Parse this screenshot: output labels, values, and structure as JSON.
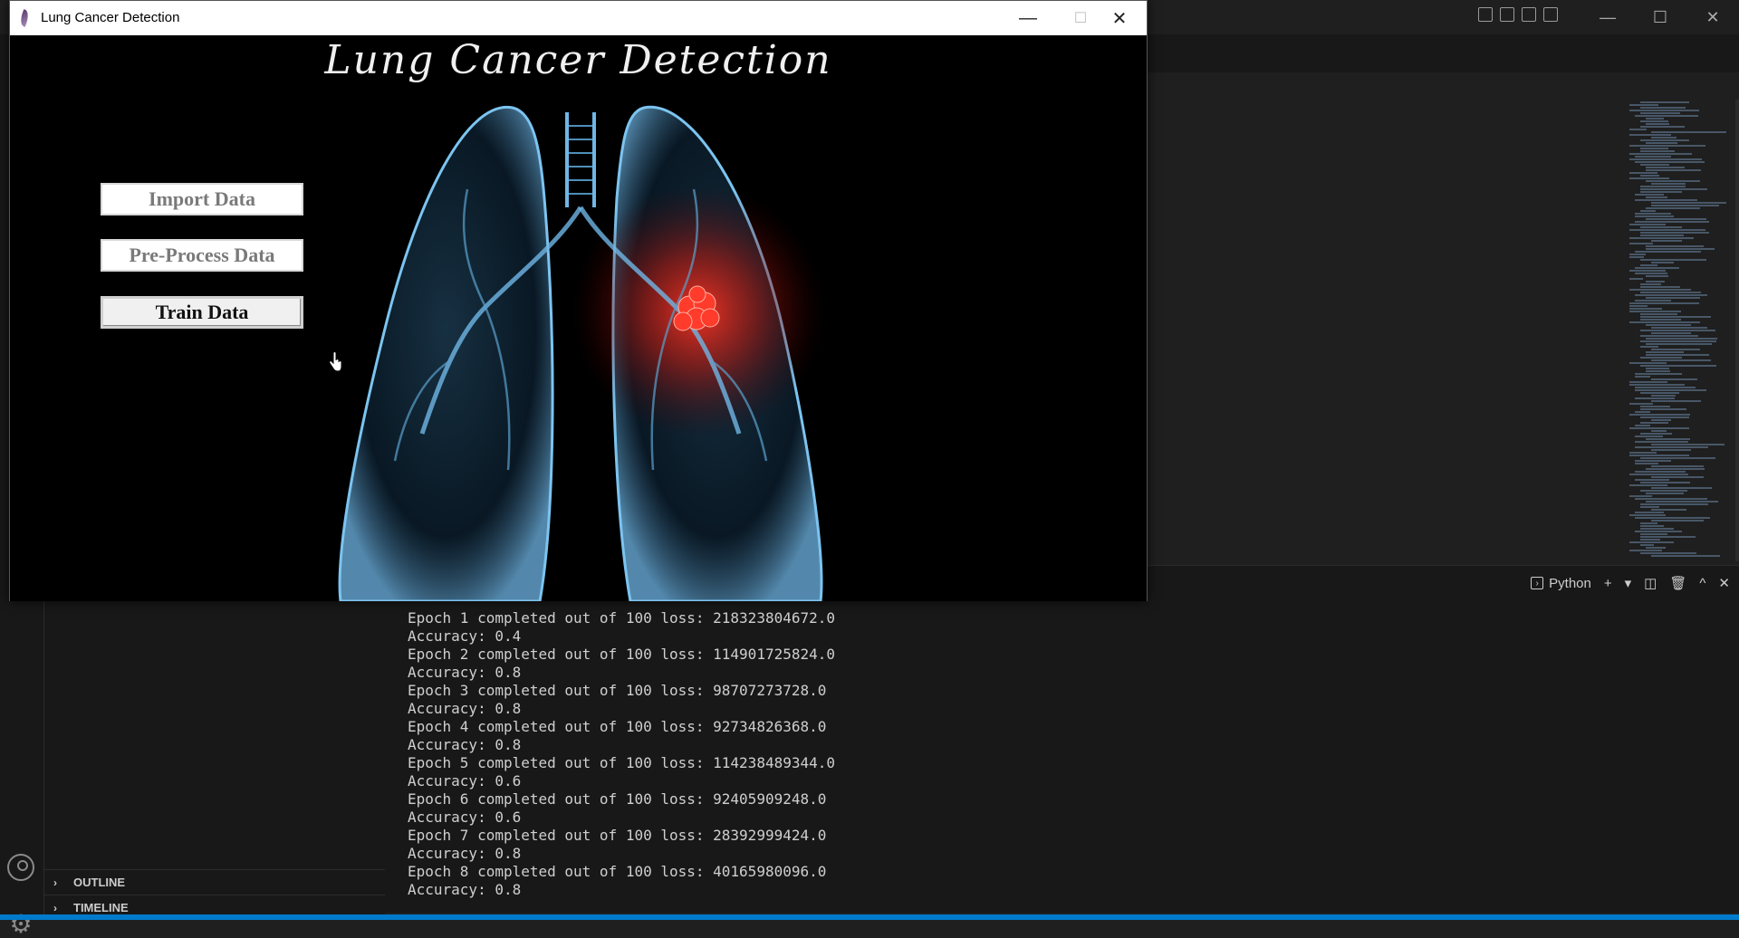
{
  "app": {
    "title": "Lung Cancer Detection",
    "heading": "Lung Cancer Detection",
    "buttons": {
      "import": "Import Data",
      "preprocess": "Pre-Process Data",
      "train": "Train Data"
    },
    "controls": {
      "minimize": "—",
      "maximize": "☐",
      "close": "✕"
    }
  },
  "vscode": {
    "terminal_profile": "Python",
    "sidebar_sections": {
      "outline": "OUTLINE",
      "timeline": "TIMELINE"
    },
    "terminal_lines": [
      "Epoch 1 completed out of 100 loss: 218323804672.0",
      "Accuracy: 0.4",
      "Epoch 2 completed out of 100 loss: 114901725824.0",
      "Accuracy: 0.8",
      "Epoch 3 completed out of 100 loss: 98707273728.0",
      "Accuracy: 0.8",
      "Epoch 4 completed out of 100 loss: 92734826368.0",
      "Accuracy: 0.8",
      "Epoch 5 completed out of 100 loss: 114238489344.0",
      "Accuracy: 0.6",
      "Epoch 6 completed out of 100 loss: 92405909248.0",
      "Accuracy: 0.6",
      "Epoch 7 completed out of 100 loss: 28392999424.0",
      "Accuracy: 0.8",
      "Epoch 8 completed out of 100 loss: 40165980096.0",
      "Accuracy: 0.8"
    ],
    "window_controls": {
      "minimize": "—",
      "maximize": "☐",
      "close": "✕"
    }
  },
  "colors": {
    "accent": "#007acc",
    "tumor": "#ff3322",
    "lung": "#5fa8d8"
  }
}
